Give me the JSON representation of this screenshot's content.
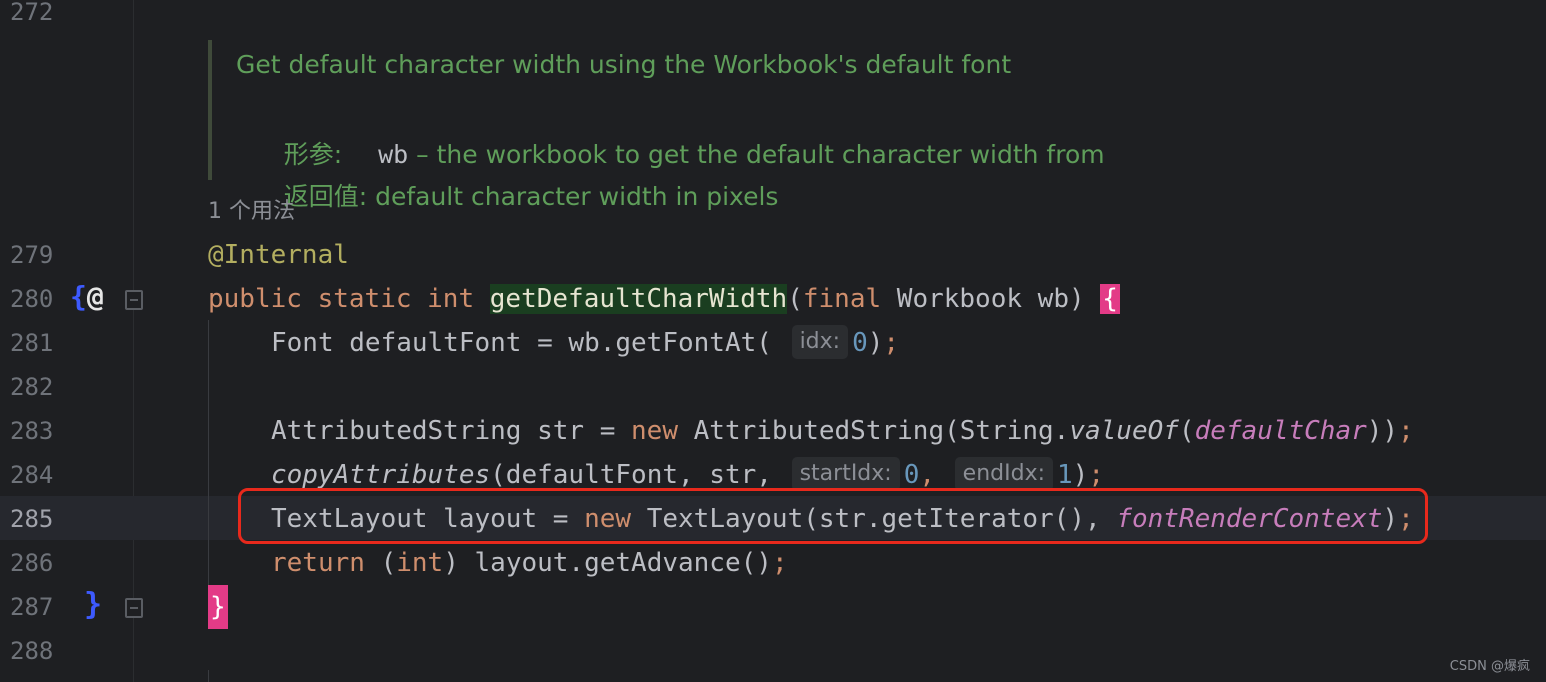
{
  "doc_comment": {
    "summary": "Get default character width using the Workbook's default font",
    "param_label": "形参:",
    "param_name": "wb",
    "param_desc": " – the workbook to get the default character width from",
    "return_label": "返回值:",
    "return_desc": " default character width in pixels"
  },
  "usage_hint": "1 个用法",
  "line_numbers": {
    "l272": "272",
    "l279": "279",
    "l280": "280",
    "l281": "281",
    "l282": "282",
    "l283": "283",
    "l284": "284",
    "l285": "285",
    "l286": "286",
    "l287": "287",
    "l288": "288"
  },
  "code": {
    "l279": {
      "annotation": "@Internal"
    },
    "l280": {
      "kw_public": "public",
      "kw_static": "static",
      "kw_int": "int",
      "method": "getDefaultCharWidth",
      "open_paren": "(",
      "kw_final": "final",
      "rest": " Workbook wb) ",
      "brace": "{"
    },
    "l281": {
      "before": "Font defaultFont = wb.getFontAt( ",
      "hint": "idx:",
      "num": "0",
      "after": ")",
      "semi": ";"
    },
    "l283": {
      "before": "AttributedString str = ",
      "kw_new": "new",
      "mid": " AttributedString(String.",
      "static_call": "valueOf",
      "open": "(",
      "field": "defaultChar",
      "close": "))",
      "semi": ";"
    },
    "l284": {
      "static_call": "copyAttributes",
      "args": "(defaultFont, str, ",
      "hint1": "startIdx:",
      "num1": "0",
      "comma": ", ",
      "hint2": "endIdx:",
      "num2": "1",
      "close": ")",
      "semi": ";"
    },
    "l285": {
      "before": "TextLayout layout = ",
      "kw_new": "new",
      "mid": " TextLayout(str.getIterator(), ",
      "field": "fontRenderContext",
      "close": ")",
      "semi": ";"
    },
    "l286": {
      "kw_return": "return",
      "mid": " (",
      "kw_int": "int",
      "rest": ") layout.getAdvance()",
      "semi": ";"
    },
    "l287": {
      "brace": "}"
    }
  },
  "gutter": {
    "l280_icon": "{@",
    "l287_icon": "}"
  },
  "watermark": "CSDN @爆疯"
}
